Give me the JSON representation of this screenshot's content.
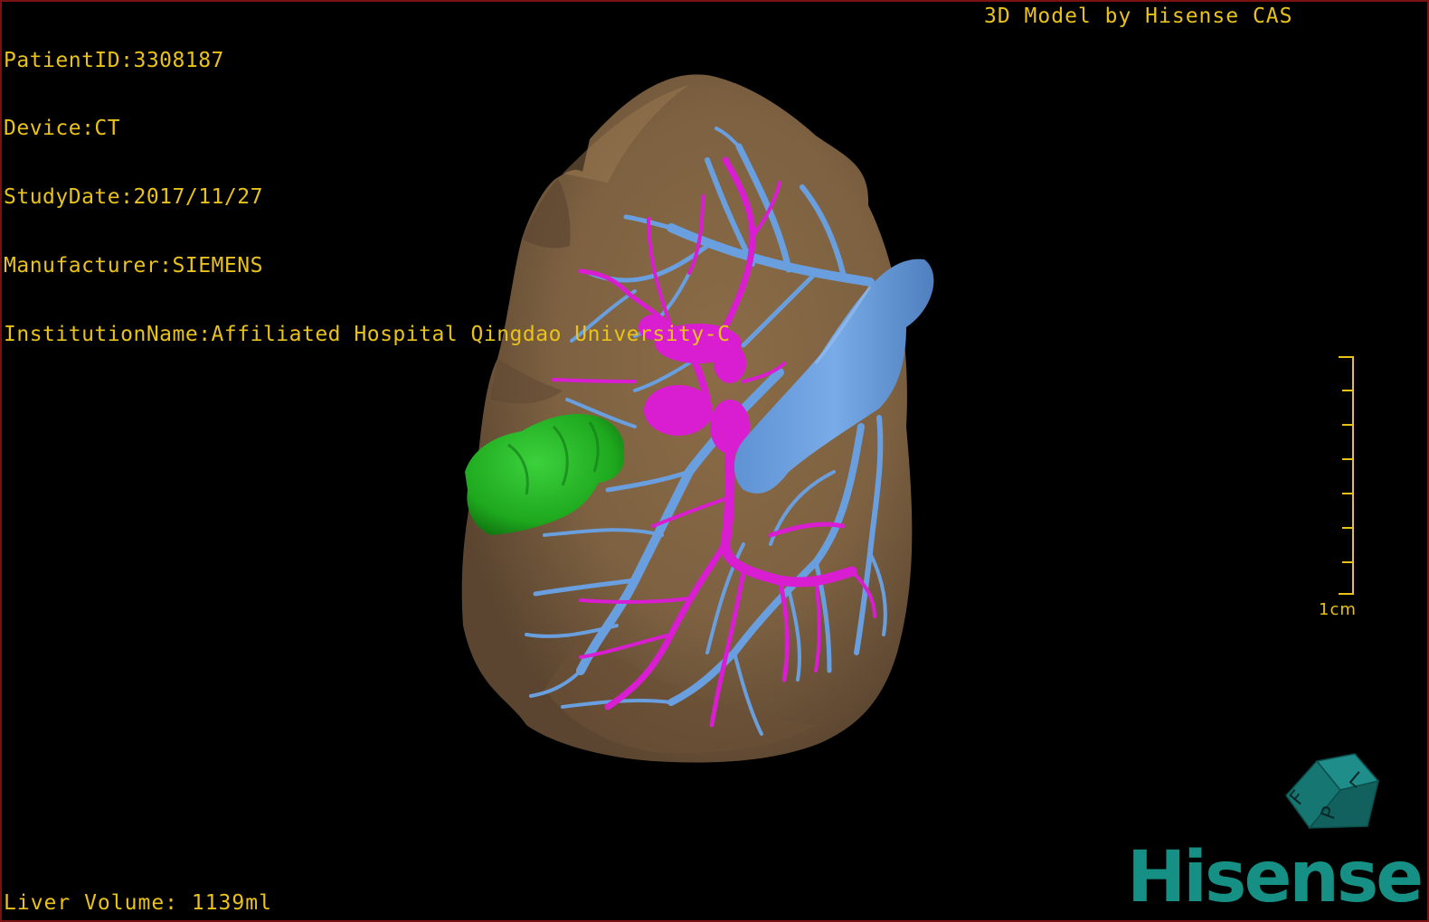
{
  "viewer": {
    "patient_id": "PatientID:3308187",
    "device": "Device:CT",
    "study_date": "StudyDate:2017/11/27",
    "manufacturer": "Manufacturer:SIEMENS",
    "institution": "InstitutionName:Affiliated Hospital Qingdao University-C",
    "credit": "3D Model by Hisense CAS",
    "liver_volume": "Liver Volume: 1139ml",
    "scale_label": "1cm",
    "brand": "Hisense"
  },
  "orientation_cube": {
    "labels": [
      "F",
      "L",
      "P"
    ]
  },
  "colors": {
    "liver": "#7d6141",
    "portal_vein": "#d81ed0",
    "hepatic_vein": "#6a9fdf",
    "lesion": "#1ea81e",
    "overlay_text": "#e9c21a",
    "brand": "#168f84",
    "border": "#7a1212"
  }
}
